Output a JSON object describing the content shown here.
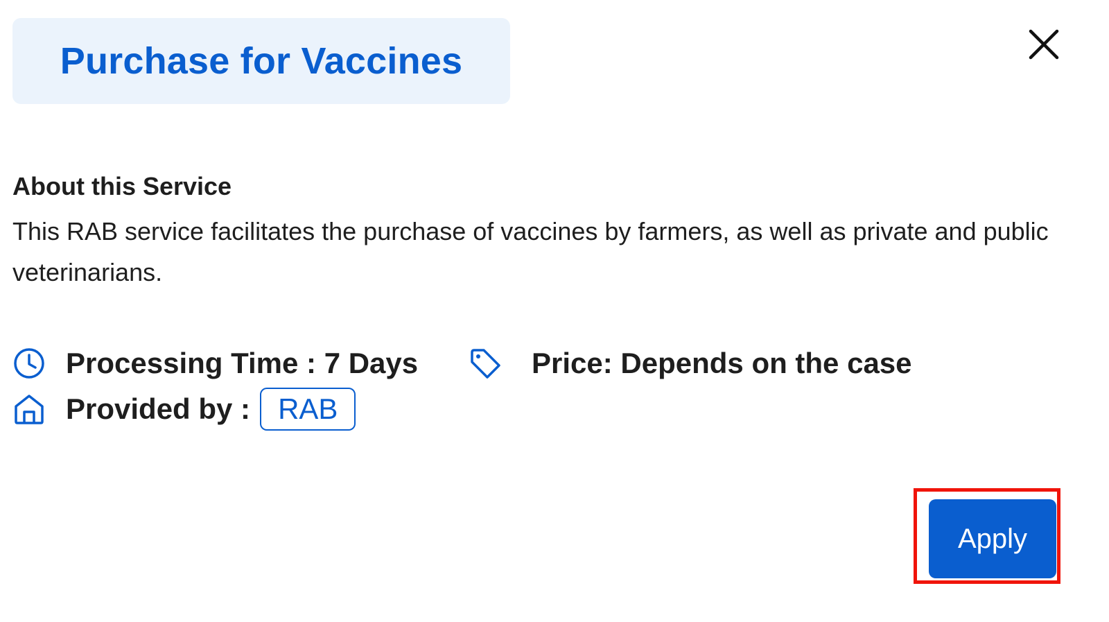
{
  "dialog": {
    "title": "Purchase for Vaccines",
    "close_icon": "close-icon"
  },
  "about": {
    "heading": "About this Service",
    "body": "This RAB service facilitates the purchase of vaccines by farmers, as well as private and public veterinarians."
  },
  "details": {
    "processing_time": "Processing Time : 7 Days",
    "processing_icon": "clock-icon",
    "price": "Price: Depends on the case",
    "price_icon": "tag-icon",
    "provided_by_label": "Provided by :",
    "provided_by_icon": "home-icon",
    "provider": "RAB"
  },
  "actions": {
    "apply_label": "Apply"
  },
  "colors": {
    "accent": "#0a5ecf",
    "title_bg": "#ebf3fc",
    "highlight": "#f0140a"
  }
}
